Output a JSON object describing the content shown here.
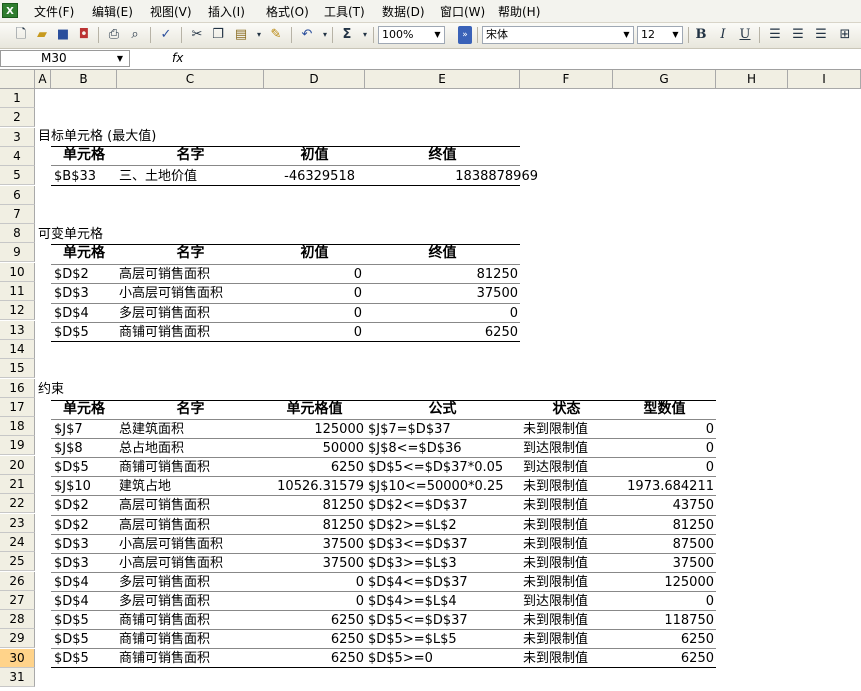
{
  "menu": [
    "文件(F)",
    "编辑(E)",
    "视图(V)",
    "插入(I)",
    "格式(O)",
    "工具(T)",
    "数据(D)",
    "窗口(W)",
    "帮助(H)"
  ],
  "toolbar": {
    "zoom": "100%",
    "font": "宋体",
    "size": "12",
    "bold": "B",
    "italic": "I",
    "underline": "U"
  },
  "namebox": "M30",
  "fx": "fx",
  "columns": [
    "A",
    "B",
    "C",
    "D",
    "E",
    "F",
    "G",
    "H",
    "I"
  ],
  "rows": [
    "1",
    "2",
    "3",
    "4",
    "5",
    "6",
    "7",
    "8",
    "9",
    "10",
    "11",
    "12",
    "13",
    "14",
    "15",
    "16",
    "17",
    "18",
    "19",
    "20",
    "21",
    "22",
    "23",
    "24",
    "25",
    "26",
    "27",
    "28",
    "29",
    "30",
    "31"
  ],
  "active_row": "30",
  "target": {
    "title": "目标单元格 (最大值)",
    "headers": [
      "单元格",
      "名字",
      "初值",
      "终值"
    ],
    "row": [
      "$B$33",
      "三、土地价值",
      "-46329518",
      "1838878969"
    ]
  },
  "variables": {
    "title": "可变单元格",
    "headers": [
      "单元格",
      "名字",
      "初值",
      "终值"
    ],
    "rows": [
      [
        "$D$2",
        "高层可销售面积",
        "0",
        "81250"
      ],
      [
        "$D$3",
        "小高层可销售面积",
        "0",
        "37500"
      ],
      [
        "$D$4",
        "多层可销售面积",
        "0",
        "0"
      ],
      [
        "$D$5",
        "商铺可销售面积",
        "0",
        "6250"
      ]
    ]
  },
  "constraints": {
    "title": "约束",
    "headers": [
      "单元格",
      "名字",
      "单元格值",
      "公式",
      "状态",
      "型数值"
    ],
    "rows": [
      [
        "$J$7",
        "总建筑面积",
        "125000",
        "$J$7=$D$37",
        "未到限制值",
        "0"
      ],
      [
        "$J$8",
        "总占地面积",
        "50000",
        "$J$8<=$D$36",
        "到达限制值",
        "0"
      ],
      [
        "$D$5",
        "商铺可销售面积",
        "6250",
        "$D$5<=$D$37*0.05",
        "到达限制值",
        "0"
      ],
      [
        "$J$10",
        "建筑占地",
        "10526.31579",
        "$J$10<=50000*0.25",
        "未到限制值",
        "1973.684211"
      ],
      [
        "$D$2",
        "高层可销售面积",
        "81250",
        "$D$2<=$D$37",
        "未到限制值",
        "43750"
      ],
      [
        "$D$2",
        "高层可销售面积",
        "81250",
        "$D$2>=$L$2",
        "未到限制值",
        "81250"
      ],
      [
        "$D$3",
        "小高层可销售面积",
        "37500",
        "$D$3<=$D$37",
        "未到限制值",
        "87500"
      ],
      [
        "$D$3",
        "小高层可销售面积",
        "37500",
        "$D$3>=$L$3",
        "未到限制值",
        "37500"
      ],
      [
        "$D$4",
        "多层可销售面积",
        "0",
        "$D$4<=$D$37",
        "未到限制值",
        "125000"
      ],
      [
        "$D$4",
        "多层可销售面积",
        "0",
        "$D$4>=$L$4",
        "到达限制值",
        "0"
      ],
      [
        "$D$5",
        "商铺可销售面积",
        "6250",
        "$D$5<=$D$37",
        "未到限制值",
        "118750"
      ],
      [
        "$D$5",
        "商铺可销售面积",
        "6250",
        "$D$5>=$L$5",
        "未到限制值",
        "6250"
      ],
      [
        "$D$5",
        "商铺可销售面积",
        "6250",
        "$D$5>=0",
        "未到限制值",
        "6250"
      ]
    ]
  }
}
